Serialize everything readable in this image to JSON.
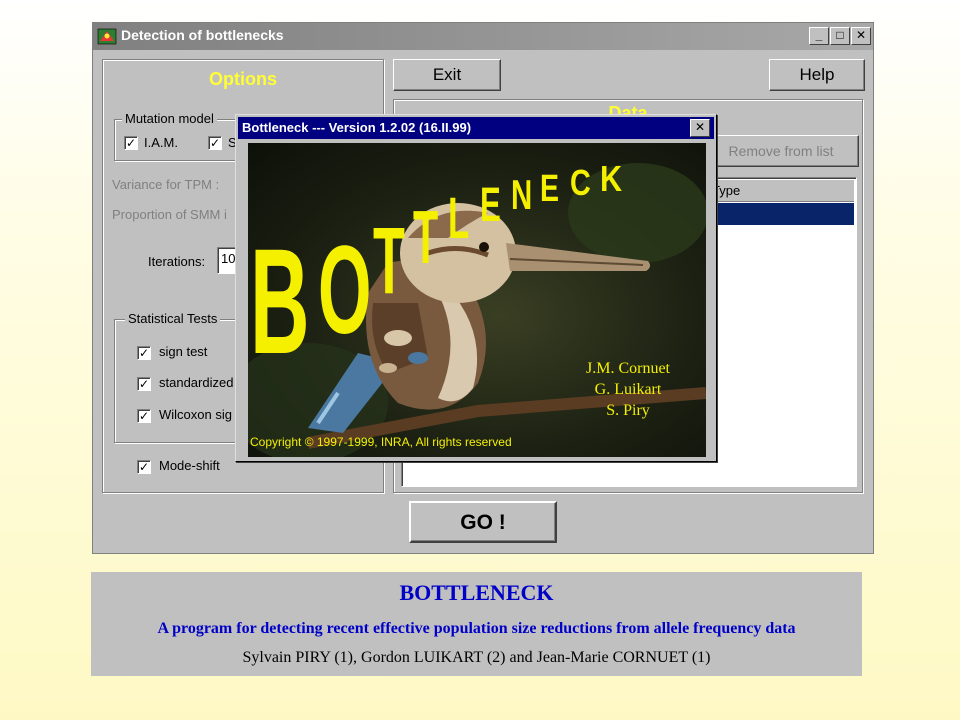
{
  "window": {
    "title": "Detection of bottlenecks",
    "controls": {
      "minimize": "_",
      "maximize": "□",
      "close": "✕"
    }
  },
  "options": {
    "heading": "Options",
    "mutation_model": {
      "legend": "Mutation model",
      "iam_label": "I.A.M.",
      "iam_checked": "✓",
      "second_label": "S",
      "second_checked": "✓"
    },
    "variance_tpm_label": "Variance for TPM :",
    "proportion_smm_label": "Proportion of SMM i",
    "iterations": {
      "label": "Iterations:",
      "value": "10"
    },
    "statistical_tests": {
      "legend": "Statistical Tests",
      "items": [
        {
          "label": "sign test",
          "checked": "✓"
        },
        {
          "label": "standardized",
          "checked": "✓"
        },
        {
          "label": "Wilcoxon sig",
          "checked": "✓"
        }
      ]
    },
    "mode_shift": {
      "label": "Mode-shift",
      "checked": "✓"
    }
  },
  "toolbar": {
    "exit_label": "Exit",
    "help_label": "Help"
  },
  "data_panel": {
    "heading_partial": "Data",
    "remove_label": "Remove from list",
    "column_type": "Type"
  },
  "go_label": "GO !",
  "dialog": {
    "title": "Bottleneck  ---  Version 1.2.02  (16.II.99)",
    "close": "✕",
    "splash": {
      "logo_text": "BOTTLENECK",
      "authors": [
        "J.M. Cornuet",
        "G. Luikart",
        "S. Piry"
      ],
      "copyright": "Copyright © 1997-1999, INRA, All rights reserved"
    }
  },
  "banner": {
    "heading": "BOTTLENECK",
    "subtitle": "A program for detecting recent effective population size reductions from allele frequency data",
    "authors": "Sylvain PIRY (1), Gordon LUIKART (2)  and Jean-Marie CORNUET (1)"
  },
  "colors": {
    "window_face": "#c0c0c0",
    "options_heading": "#ffff33",
    "dialog_title_bar": "#000080",
    "selection": "#0a246a",
    "banner_text": "#0000c8",
    "logo_yellow": "#f4f000"
  }
}
